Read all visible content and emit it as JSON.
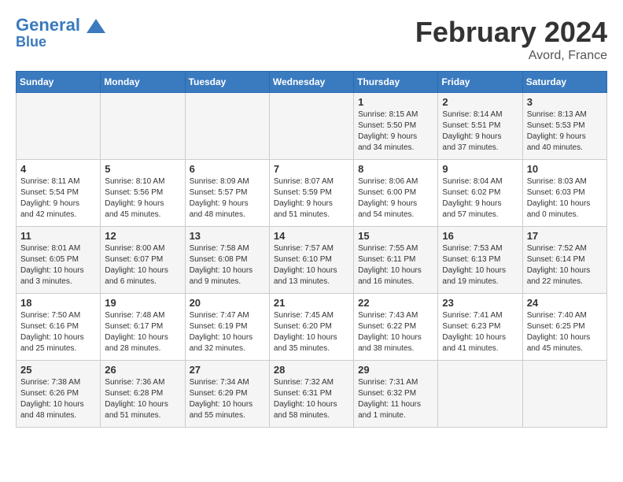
{
  "header": {
    "logo_line1": "General",
    "logo_line2": "Blue",
    "month_title": "February 2024",
    "location": "Avord, France"
  },
  "days_of_week": [
    "Sunday",
    "Monday",
    "Tuesday",
    "Wednesday",
    "Thursday",
    "Friday",
    "Saturday"
  ],
  "weeks": [
    [
      {
        "day": "",
        "info": ""
      },
      {
        "day": "",
        "info": ""
      },
      {
        "day": "",
        "info": ""
      },
      {
        "day": "",
        "info": ""
      },
      {
        "day": "1",
        "info": "Sunrise: 8:15 AM\nSunset: 5:50 PM\nDaylight: 9 hours\nand 34 minutes."
      },
      {
        "day": "2",
        "info": "Sunrise: 8:14 AM\nSunset: 5:51 PM\nDaylight: 9 hours\nand 37 minutes."
      },
      {
        "day": "3",
        "info": "Sunrise: 8:13 AM\nSunset: 5:53 PM\nDaylight: 9 hours\nand 40 minutes."
      }
    ],
    [
      {
        "day": "4",
        "info": "Sunrise: 8:11 AM\nSunset: 5:54 PM\nDaylight: 9 hours\nand 42 minutes."
      },
      {
        "day": "5",
        "info": "Sunrise: 8:10 AM\nSunset: 5:56 PM\nDaylight: 9 hours\nand 45 minutes."
      },
      {
        "day": "6",
        "info": "Sunrise: 8:09 AM\nSunset: 5:57 PM\nDaylight: 9 hours\nand 48 minutes."
      },
      {
        "day": "7",
        "info": "Sunrise: 8:07 AM\nSunset: 5:59 PM\nDaylight: 9 hours\nand 51 minutes."
      },
      {
        "day": "8",
        "info": "Sunrise: 8:06 AM\nSunset: 6:00 PM\nDaylight: 9 hours\nand 54 minutes."
      },
      {
        "day": "9",
        "info": "Sunrise: 8:04 AM\nSunset: 6:02 PM\nDaylight: 9 hours\nand 57 minutes."
      },
      {
        "day": "10",
        "info": "Sunrise: 8:03 AM\nSunset: 6:03 PM\nDaylight: 10 hours\nand 0 minutes."
      }
    ],
    [
      {
        "day": "11",
        "info": "Sunrise: 8:01 AM\nSunset: 6:05 PM\nDaylight: 10 hours\nand 3 minutes."
      },
      {
        "day": "12",
        "info": "Sunrise: 8:00 AM\nSunset: 6:07 PM\nDaylight: 10 hours\nand 6 minutes."
      },
      {
        "day": "13",
        "info": "Sunrise: 7:58 AM\nSunset: 6:08 PM\nDaylight: 10 hours\nand 9 minutes."
      },
      {
        "day": "14",
        "info": "Sunrise: 7:57 AM\nSunset: 6:10 PM\nDaylight: 10 hours\nand 13 minutes."
      },
      {
        "day": "15",
        "info": "Sunrise: 7:55 AM\nSunset: 6:11 PM\nDaylight: 10 hours\nand 16 minutes."
      },
      {
        "day": "16",
        "info": "Sunrise: 7:53 AM\nSunset: 6:13 PM\nDaylight: 10 hours\nand 19 minutes."
      },
      {
        "day": "17",
        "info": "Sunrise: 7:52 AM\nSunset: 6:14 PM\nDaylight: 10 hours\nand 22 minutes."
      }
    ],
    [
      {
        "day": "18",
        "info": "Sunrise: 7:50 AM\nSunset: 6:16 PM\nDaylight: 10 hours\nand 25 minutes."
      },
      {
        "day": "19",
        "info": "Sunrise: 7:48 AM\nSunset: 6:17 PM\nDaylight: 10 hours\nand 28 minutes."
      },
      {
        "day": "20",
        "info": "Sunrise: 7:47 AM\nSunset: 6:19 PM\nDaylight: 10 hours\nand 32 minutes."
      },
      {
        "day": "21",
        "info": "Sunrise: 7:45 AM\nSunset: 6:20 PM\nDaylight: 10 hours\nand 35 minutes."
      },
      {
        "day": "22",
        "info": "Sunrise: 7:43 AM\nSunset: 6:22 PM\nDaylight: 10 hours\nand 38 minutes."
      },
      {
        "day": "23",
        "info": "Sunrise: 7:41 AM\nSunset: 6:23 PM\nDaylight: 10 hours\nand 41 minutes."
      },
      {
        "day": "24",
        "info": "Sunrise: 7:40 AM\nSunset: 6:25 PM\nDaylight: 10 hours\nand 45 minutes."
      }
    ],
    [
      {
        "day": "25",
        "info": "Sunrise: 7:38 AM\nSunset: 6:26 PM\nDaylight: 10 hours\nand 48 minutes."
      },
      {
        "day": "26",
        "info": "Sunrise: 7:36 AM\nSunset: 6:28 PM\nDaylight: 10 hours\nand 51 minutes."
      },
      {
        "day": "27",
        "info": "Sunrise: 7:34 AM\nSunset: 6:29 PM\nDaylight: 10 hours\nand 55 minutes."
      },
      {
        "day": "28",
        "info": "Sunrise: 7:32 AM\nSunset: 6:31 PM\nDaylight: 10 hours\nand 58 minutes."
      },
      {
        "day": "29",
        "info": "Sunrise: 7:31 AM\nSunset: 6:32 PM\nDaylight: 11 hours\nand 1 minute."
      },
      {
        "day": "",
        "info": ""
      },
      {
        "day": "",
        "info": ""
      }
    ]
  ]
}
